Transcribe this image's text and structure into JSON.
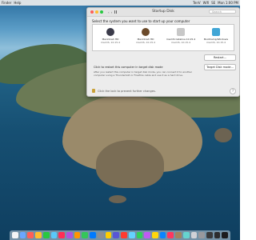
{
  "menubar": {
    "left": [
      "Finder",
      "Help"
    ],
    "right": [
      "TenV",
      "Wifi",
      "SE",
      "Mon 1:00 PM"
    ]
  },
  "window": {
    "title": "Startup Disk",
    "search_placeholder": "Search",
    "nav_back": "‹",
    "nav_forward": "›"
  },
  "startup": {
    "instruction": "Select the system you want to use to start up your computer",
    "disks": [
      {
        "name": "Macintosh HD",
        "os": "macOS, 10.15.4",
        "color": "#3b3b4a"
      },
      {
        "name": "Macintosh HD",
        "os": "macOS, 10.15.4",
        "color": "#6b4a2a"
      },
      {
        "name": "macOS Catalina 10.15.4",
        "os": "macOS, 10.15.4",
        "color": "#bcbcbc"
      },
      {
        "name": "BootCamp/Windows",
        "os": "macOS, 10.15.4",
        "color": "#41a6d6"
      }
    ],
    "restart_label": "Restart...",
    "target_label": "Target Disk mode...",
    "target_heading": "Click to restart this computer in target disk mode",
    "target_desc": "After you restart this computer in target disk mode, you can connect it to another computer using a Thunderbolt or FireWire cable and use it as a hard drive."
  },
  "footer": {
    "lock_text": "Click the lock to prevent further changes.",
    "help": "?"
  },
  "dock_colors": [
    "#f5f5f5",
    "#6aa6ff",
    "#ff5f57",
    "#ffbd2e",
    "#28c840",
    "#5ac8fa",
    "#ff2d55",
    "#af52de",
    "#ff9500",
    "#34c759",
    "#007aff",
    "#8e8e93",
    "#ffcc00",
    "#5856d6",
    "#ff3b30",
    "#64d2ff",
    "#30d158",
    "#bf5af2",
    "#ffd60a",
    "#0a84ff",
    "#ff375f",
    "#a2845e",
    "#66d4cf",
    "#d1d1d6",
    "#98989d",
    "#3a3a3c",
    "#2c2c2e",
    "#1c1c1e"
  ]
}
